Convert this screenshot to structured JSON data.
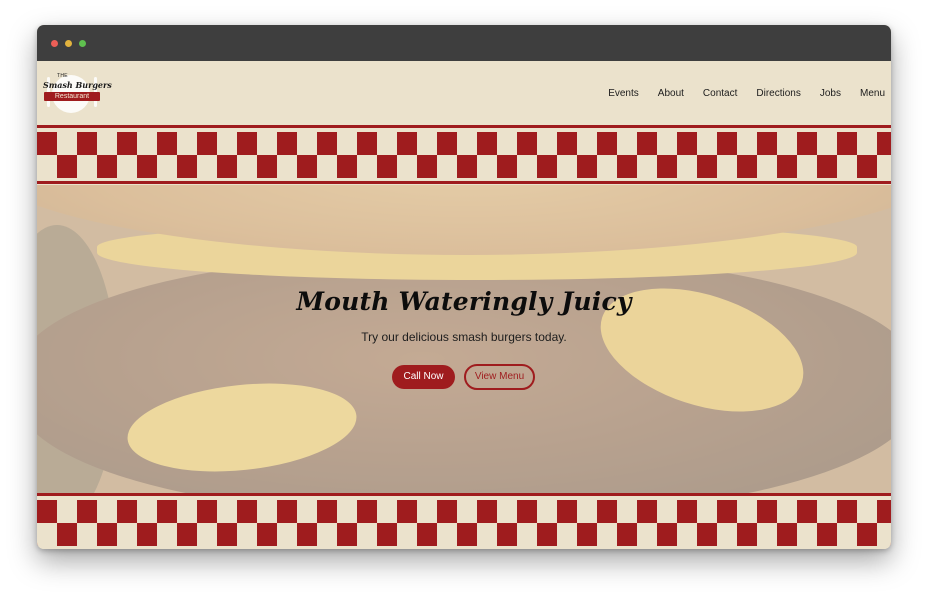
{
  "logo": {
    "the": "THE",
    "name": "Smash Burgers",
    "sub": "Restaurant"
  },
  "nav": [
    {
      "label": "Events"
    },
    {
      "label": "About"
    },
    {
      "label": "Contact"
    },
    {
      "label": "Directions"
    },
    {
      "label": "Jobs"
    },
    {
      "label": "Menu"
    }
  ],
  "hero": {
    "title": "Mouth Wateringly Juicy",
    "subtitle": "Try our delicious smash burgers today.",
    "call_label": "Call Now",
    "menu_label": "View Menu"
  },
  "colors": {
    "brand_red": "#9f1c1e",
    "cream": "#ebe2cc",
    "titlebar": "#3e3e3e"
  }
}
